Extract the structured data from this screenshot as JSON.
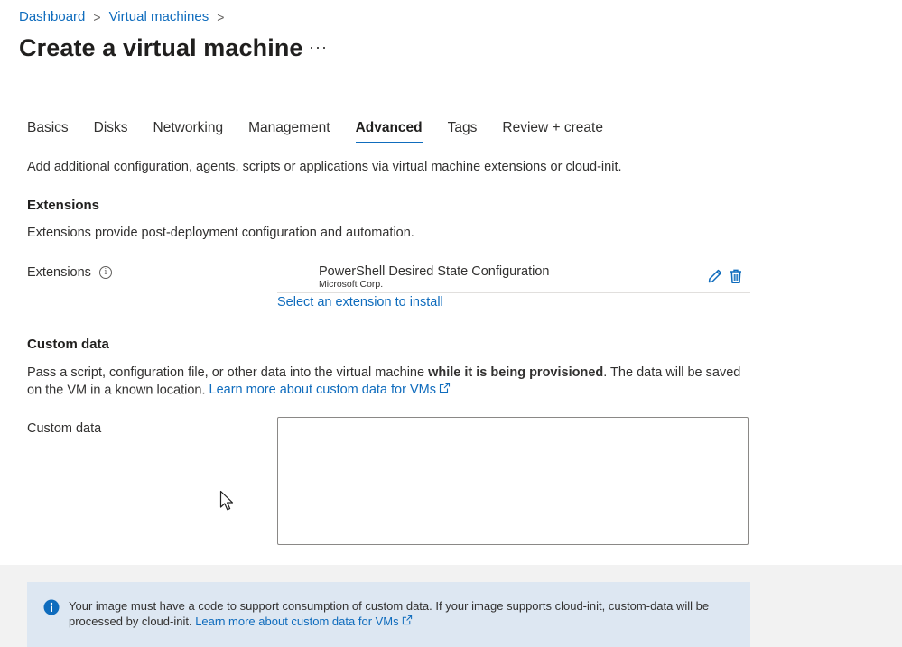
{
  "breadcrumb": {
    "items": [
      "Dashboard",
      "Virtual machines"
    ],
    "separator": ">"
  },
  "page": {
    "title": "Create a virtual machine",
    "more_label": "···"
  },
  "tabs": [
    {
      "label": "Basics",
      "active": false
    },
    {
      "label": "Disks",
      "active": false
    },
    {
      "label": "Networking",
      "active": false
    },
    {
      "label": "Management",
      "active": false
    },
    {
      "label": "Advanced",
      "active": true
    },
    {
      "label": "Tags",
      "active": false
    },
    {
      "label": "Review + create",
      "active": false
    }
  ],
  "advanced": {
    "description": "Add additional configuration, agents, scripts or applications via virtual machine extensions or cloud-init."
  },
  "extensions": {
    "heading": "Extensions",
    "description": "Extensions provide post-deployment configuration and automation.",
    "field_label": "Extensions",
    "info_glyph": "i",
    "items": [
      {
        "name": "PowerShell Desired State Configuration",
        "publisher": "Microsoft Corp."
      }
    ],
    "select_link": "Select an extension to install"
  },
  "custom_data": {
    "heading": "Custom data",
    "desc_part1": "Pass a script, configuration file, or other data into the virtual machine ",
    "desc_bold": "while it is being provisioned",
    "desc_part2": ". The data will be saved on the VM in a known location. ",
    "learn_more": "Learn more about custom data for VMs",
    "field_label": "Custom data",
    "value": ""
  },
  "info_banner": {
    "text": "Your image must have a code to support consumption of custom data. If your image supports cloud-init, custom-data will be processed by cloud-init. ",
    "learn_more": "Learn more about custom data for VMs"
  },
  "colors": {
    "accent": "#0f6cbd",
    "info_bg": "#dde7f2",
    "info_icon": "#0f6cbd"
  }
}
